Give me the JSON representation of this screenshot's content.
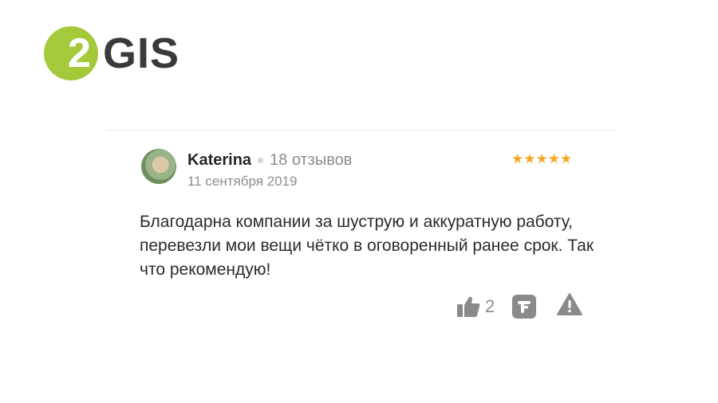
{
  "brand": {
    "logo_digit": "2",
    "logo_text": "GIS",
    "accent": "#a4c93a"
  },
  "review": {
    "author": "Katerina",
    "review_count": "18 отзывов",
    "date": "11 сентября 2019",
    "rating": 5,
    "stars": "★★★★★",
    "text": "Благодарна компании за шуструю и аккуратную работу, перевезли мои вещи чётко в оговоренный ранее срок. Так что рекомендую!",
    "likes": "2"
  },
  "icons": {
    "like": "thumbs-up-icon",
    "reply": "reply-icon",
    "report": "warning-icon"
  },
  "colors": {
    "star": "#f5a623",
    "muted": "#8c8c8c"
  }
}
